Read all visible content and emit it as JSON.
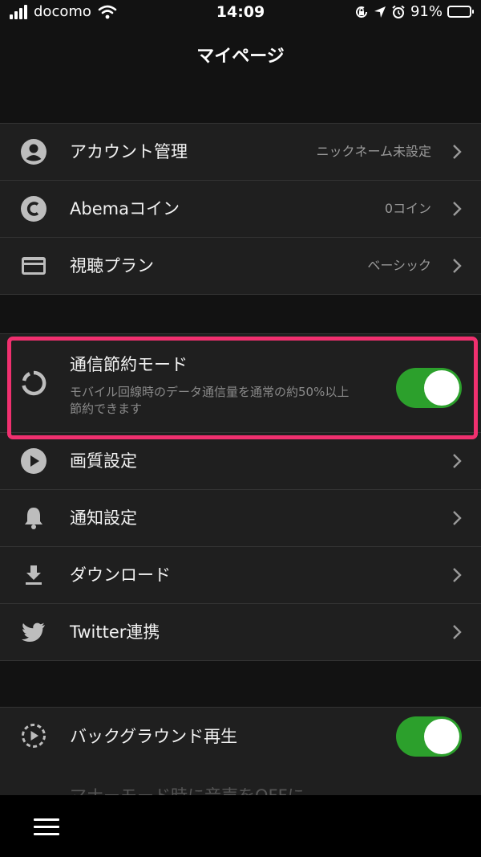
{
  "status_bar": {
    "carrier": "docomo",
    "time": "14:09",
    "battery_percent": "91%",
    "battery_level": 0.91,
    "icons": [
      "signal-icon",
      "wifi-icon",
      "screen-lock-icon",
      "location-icon",
      "alarm-icon",
      "battery-icon"
    ]
  },
  "header": {
    "title": "マイページ"
  },
  "account_group": {
    "items": [
      {
        "icon": "user-icon",
        "label": "アカウント管理",
        "value": "ニックネーム未設定"
      },
      {
        "icon": "coin-icon",
        "label": "Abemaコイン",
        "value": "0コイン"
      },
      {
        "icon": "card-icon",
        "label": "視聴プラン",
        "value": "ベーシック"
      }
    ]
  },
  "data_saver": {
    "icon": "loading-circle-icon",
    "label": "通信節約モード",
    "description": "モバイル回線時のデータ通信量を通常の約50%以上節約できます",
    "enabled": true
  },
  "settings_group": {
    "items": [
      {
        "icon": "play-icon",
        "label": "画質設定"
      },
      {
        "icon": "bell-icon",
        "label": "通知設定"
      },
      {
        "icon": "download-icon",
        "label": "ダウンロード"
      },
      {
        "icon": "twitter-icon",
        "label": "Twitter連携"
      }
    ]
  },
  "background_play": {
    "icon": "dashed-play-icon",
    "label": "バックグラウンド再生",
    "enabled": true,
    "partial_text": "マナーモード時に音声をOFFに"
  },
  "colors": {
    "toggle_on": "#2ca02c",
    "highlight": "#f0306f",
    "background": "#121212",
    "cell": "#1f1f1f"
  },
  "bottom_bar": {
    "icon": "hamburger-menu-icon"
  }
}
